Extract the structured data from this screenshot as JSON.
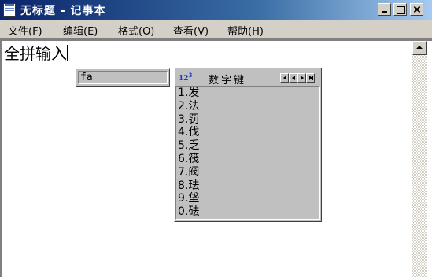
{
  "window": {
    "title": "无标题 - 记事本"
  },
  "menu": [
    {
      "label": "文件(F)"
    },
    {
      "label": "编辑(E)"
    },
    {
      "label": "格式(O)"
    },
    {
      "label": "查看(V)"
    },
    {
      "label": "帮助(H)"
    }
  ],
  "editor": {
    "text": "全拼输入"
  },
  "ime": {
    "composition": "fa",
    "candidate_title": "数字键",
    "candidates": [
      {
        "index": "1.",
        "char": "发"
      },
      {
        "index": "2.",
        "char": "法"
      },
      {
        "index": "3.",
        "char": "罚"
      },
      {
        "index": "4.",
        "char": "伐"
      },
      {
        "index": "5.",
        "char": "乏"
      },
      {
        "index": "6.",
        "char": "筏"
      },
      {
        "index": "7.",
        "char": "阀"
      },
      {
        "index": "8.",
        "char": "珐"
      },
      {
        "index": "9.",
        "char": "垡"
      },
      {
        "index": "0.",
        "char": "砝"
      }
    ]
  },
  "icons": {
    "app": "notepad-icon",
    "candidate": "number-keys-icon"
  }
}
